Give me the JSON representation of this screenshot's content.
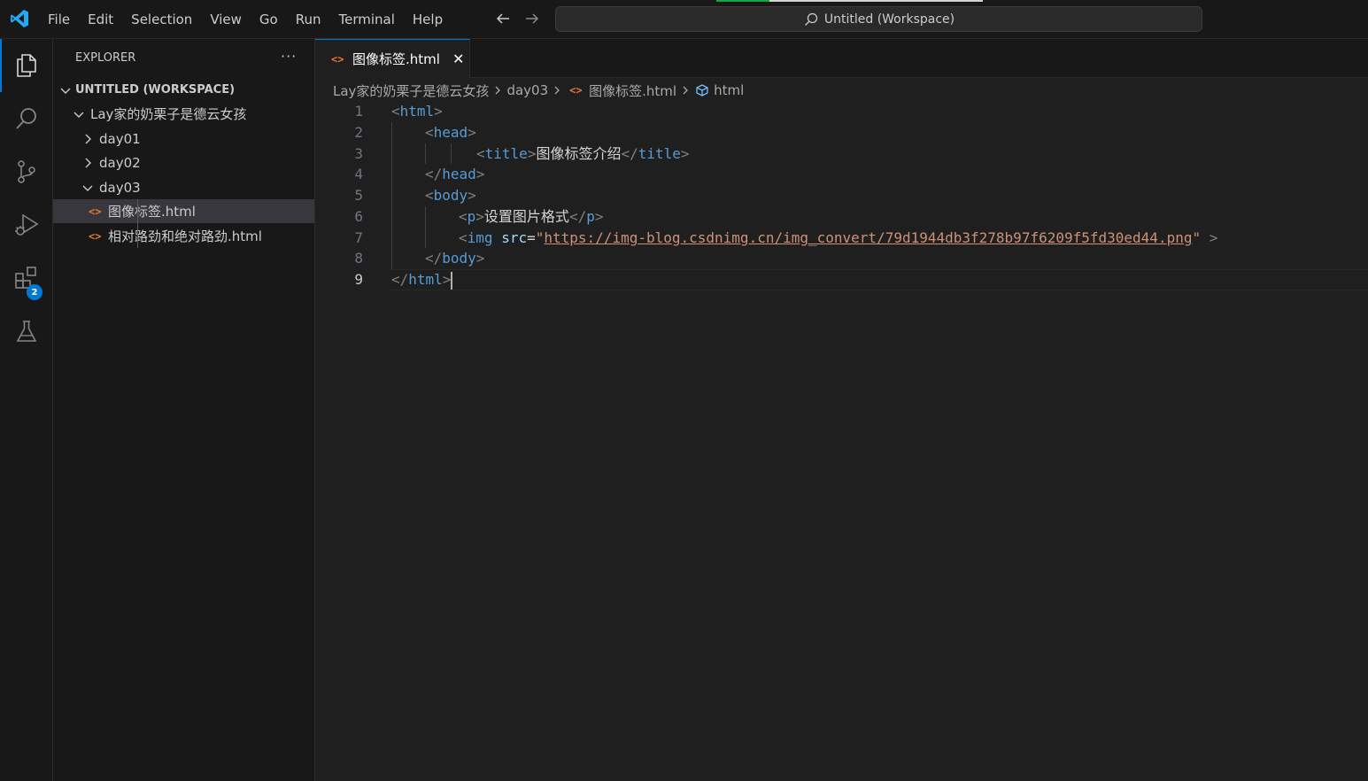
{
  "titlebar": {
    "menu": [
      "File",
      "Edit",
      "Selection",
      "View",
      "Go",
      "Run",
      "Terminal",
      "Help"
    ],
    "command_center": "Untitled (Workspace)"
  },
  "activitybar": {
    "items": [
      "explorer",
      "search",
      "source-control",
      "run-debug",
      "extensions",
      "testing"
    ],
    "extensions_badge": "2"
  },
  "sidebar": {
    "header": "EXPLORER",
    "more": "···",
    "workspace": "UNTITLED (WORKSPACE)",
    "root_folder": "Lay家的奶栗子是德云女孩",
    "folders": [
      "day01",
      "day02",
      "day03"
    ],
    "files": [
      "图像标签.html",
      "相对路劲和绝对路劲.html"
    ]
  },
  "tab": {
    "label": "图像标签.html",
    "close": "✕"
  },
  "breadcrumbs": {
    "root": "Lay家的奶栗子是德云女孩",
    "folder": "day03",
    "file": "图像标签.html",
    "symbol": "html"
  },
  "editor": {
    "line_numbers": [
      "1",
      "2",
      "3",
      "4",
      "5",
      "6",
      "7",
      "8",
      "9"
    ],
    "current_line": "9",
    "head_title": "图像标签介绍",
    "paragraph": "设置图片格式",
    "img_src": "https://img-blog.csdnimg.cn/img_convert/79d1944db3f278b97f6209f5fd30ed44.png"
  },
  "colors": {
    "accent": "#0078d4",
    "file_icon": "#e37933"
  }
}
